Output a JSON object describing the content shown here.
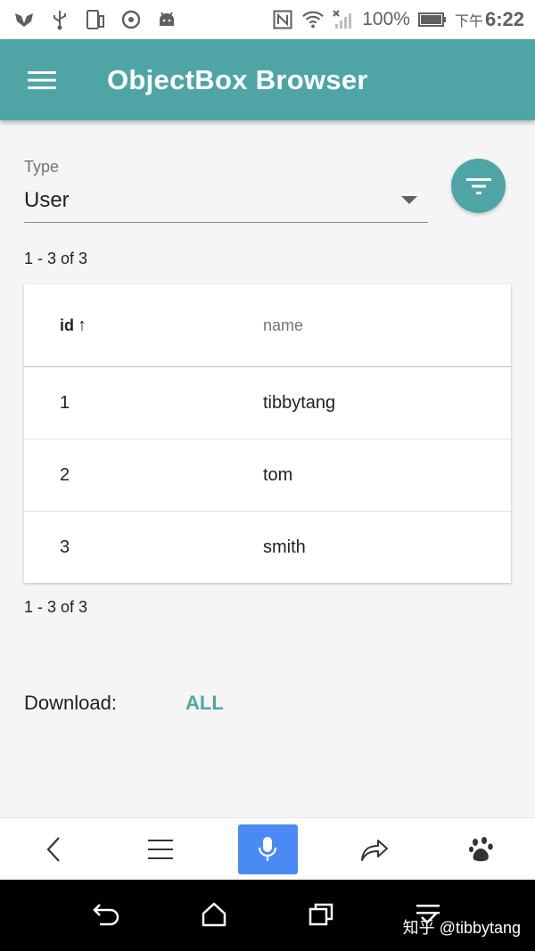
{
  "status_bar": {
    "battery": "100%",
    "time_prefix": "下午",
    "time": "6:22"
  },
  "app_bar": {
    "title": "ObjectBox Browser"
  },
  "type_select": {
    "label": "Type",
    "value": "User"
  },
  "pagination": {
    "top": "1 - 3 of 3",
    "bottom": "1 - 3 of 3"
  },
  "table": {
    "columns": [
      "id",
      "name"
    ],
    "sort_indicator": "↑",
    "rows": [
      {
        "id": "1",
        "name": "tibbytang"
      },
      {
        "id": "2",
        "name": "tom"
      },
      {
        "id": "3",
        "name": "smith"
      }
    ]
  },
  "download": {
    "label": "Download:",
    "link": "ALL"
  },
  "watermark": "知乎 @tibbytang",
  "colors": {
    "primary": "#4fa5a6",
    "mic_accent": "#4a8af4"
  }
}
